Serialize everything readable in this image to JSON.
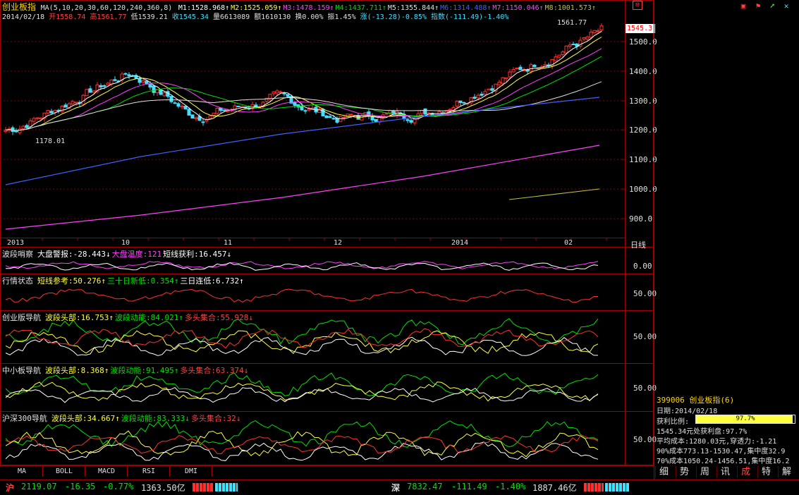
{
  "header": {
    "name": "创业板指",
    "ma_params": "MA(5,10,20,30,60,120,240,360,8)",
    "ma_values": [
      {
        "label": "M1:1528.968",
        "color": "#ffffff"
      },
      {
        "label": "M2:1525.059",
        "color": "#ffff40"
      },
      {
        "label": "M3:1478.159",
        "color": "#ff40ff"
      },
      {
        "label": "M4:1437.711",
        "color": "#00e000"
      },
      {
        "label": "M5:1355.844",
        "color": "#e0e0e0"
      },
      {
        "label": "M6:1314.488",
        "color": "#4060ff"
      },
      {
        "label": "M7:1150.046",
        "color": "#ff40ff"
      },
      {
        "label": "M8:1001.573",
        "color": "#c0c040"
      }
    ],
    "quote_line": {
      "date": "2014/02/18",
      "open": "开1558.74",
      "high": "高1561.77",
      "low": "低1539.21",
      "close": "收1545.34",
      "volume": "量6613089",
      "amount": "额1610130",
      "turnover": "换0.00%",
      "amplitude": "振1.45%",
      "change": "涨(-13.28)-0.85%",
      "index": "指数(-111.49)-1.40%"
    }
  },
  "price_axis": [
    "1500.0",
    "1400.0",
    "1300.0",
    "1200.0",
    "1100.0",
    "1000.0",
    "900.0"
  ],
  "current_price_tag": "1545.3",
  "high_label": "1561.77",
  "low_label": "1178.01",
  "date_axis": {
    "labels": [
      "2013",
      "10",
      "11",
      "12",
      "2014",
      "02"
    ],
    "period": "日线"
  },
  "indicators": [
    {
      "name": "波段哨察",
      "items": [
        {
          "text": "大盘警报:-28.443↓",
          "color": "#ffffff"
        },
        {
          "text": "大盘温度:121",
          "color": "#ff40ff"
        },
        {
          "text": "短线获利:16.457↓",
          "color": "#ffffff"
        }
      ],
      "axis": "0.00"
    },
    {
      "name": "行情状态",
      "items": [
        {
          "text": "短线参考:50.276↑",
          "color": "#ffff40"
        },
        {
          "text": "三十日新低:0.354↑",
          "color": "#00e000"
        },
        {
          "text": "三日连低:6.732↑",
          "color": "#ffffff"
        }
      ],
      "axis": "50.00"
    },
    {
      "name": "创业版导航",
      "items": [
        {
          "text": "波段头部:16.753↑",
          "color": "#ffff40"
        },
        {
          "text": "波段动能:84.021↑",
          "color": "#00e000"
        },
        {
          "text": "多头集合:55.928↓",
          "color": "#ff4040"
        }
      ],
      "axis": "50.00"
    },
    {
      "name": "中小板导航",
      "items": [
        {
          "text": "波段头部:8.368↑",
          "color": "#ffff40"
        },
        {
          "text": "波段动能:91.495↑",
          "color": "#00e000"
        },
        {
          "text": "多头集合:63.374↓",
          "color": "#ff4040"
        }
      ],
      "axis": "50.00"
    },
    {
      "name": "沪深300导航",
      "items": [
        {
          "text": "波段头部:34.667↑",
          "color": "#ffff40"
        },
        {
          "text": "波段动能:83.333↓",
          "color": "#00e000"
        },
        {
          "text": "多头集合:32↓",
          "color": "#ff4040"
        }
      ],
      "axis": "50.00"
    }
  ],
  "bottom_tabs": [
    "MA",
    "BOLL",
    "MACD",
    "RSI",
    "DMI"
  ],
  "info_panel": {
    "code_name": "399006 创业板指(6)",
    "date": "日期:2014/02/18",
    "profit_label": "获利比例:",
    "profit_value": "97.7%",
    "profit_ratio": 0.977,
    "lines": [
      "1545.34元处获利盘:97.7%",
      "平均成本:1280.03元,穿透力:-1.21",
      "90%成本773.13-1530.47,集中度32.9",
      "70%成本1050.24-1456.51,集中度16.2"
    ]
  },
  "side_tabs": [
    "细",
    "势",
    "周",
    "讯",
    "成",
    "特",
    "解"
  ],
  "status_bar": {
    "sh_label": "沪",
    "sh_index": "2119.07",
    "sh_change": "-16.35",
    "sh_pct": "-0.77%",
    "sh_amount": "1363.50亿",
    "sz_label": "深",
    "sz_index": "7832.47",
    "sz_change": "-111.49",
    "sz_pct": "-1.40%",
    "sz_amount": "1887.46亿"
  }
}
